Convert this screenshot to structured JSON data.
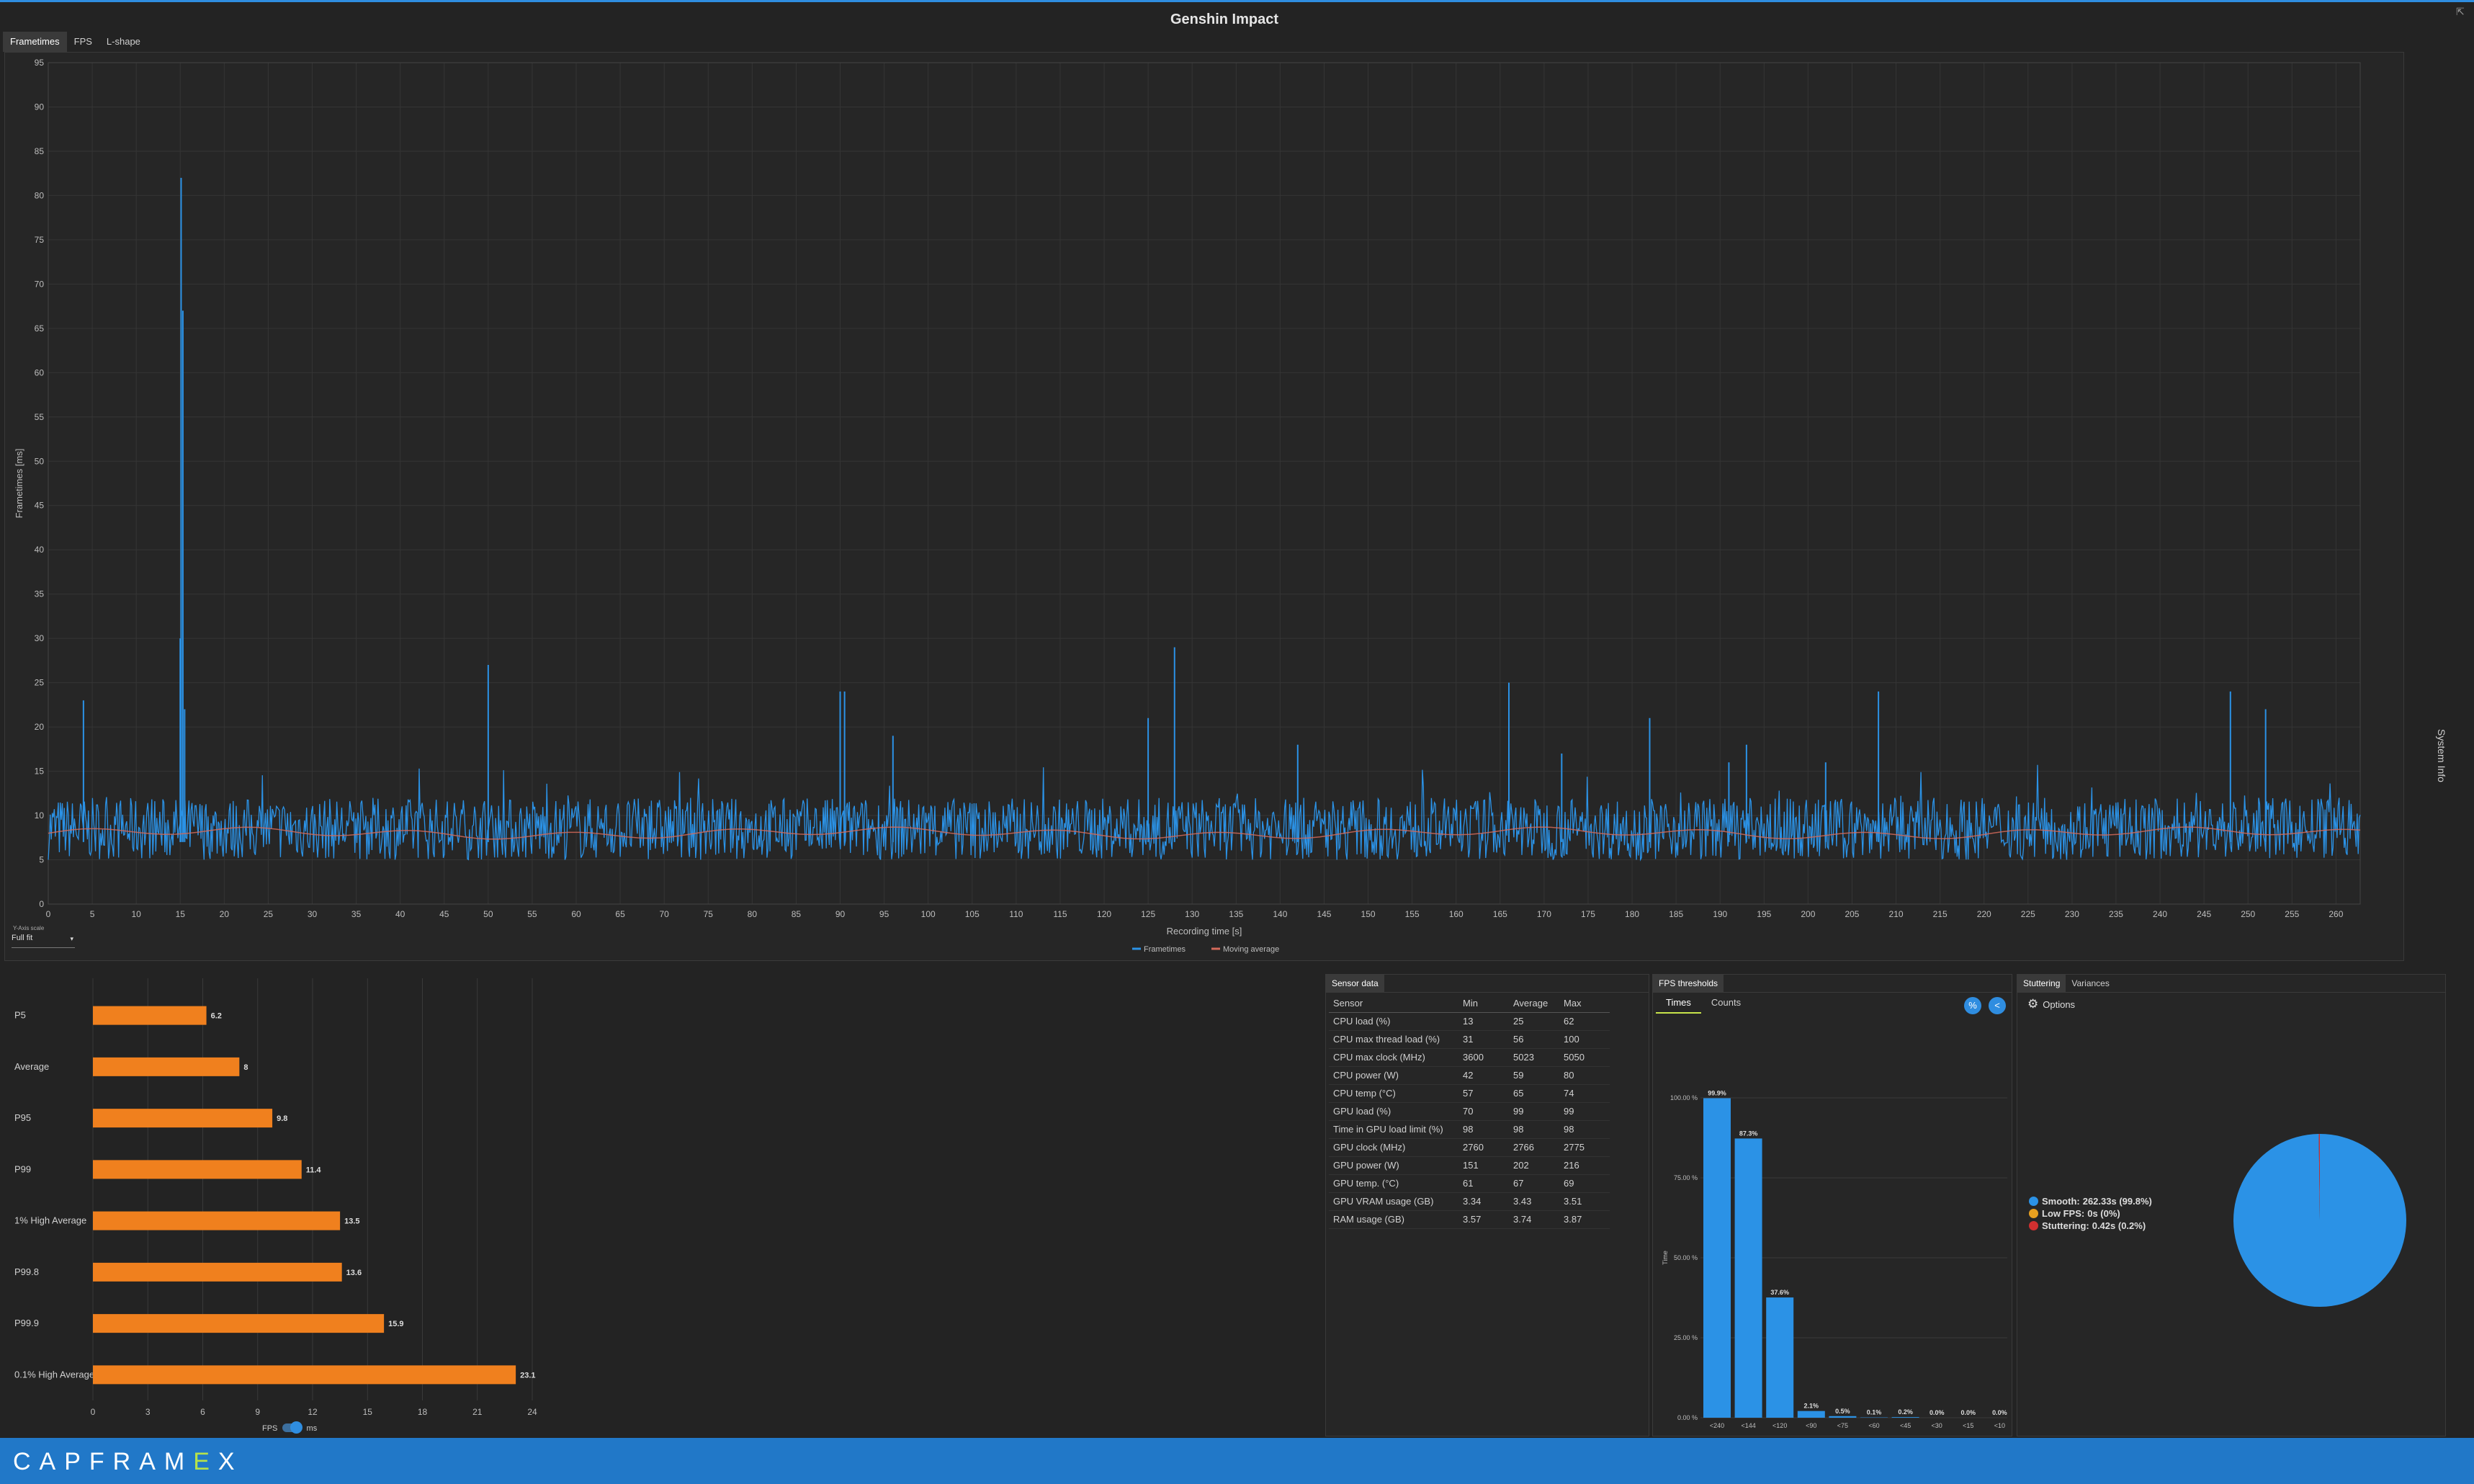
{
  "app": {
    "title": "Genshin Impact",
    "brand_pre": "CAPFRAM",
    "brand_accent": "E",
    "brand_post": "X",
    "restore_glyph": "⇱"
  },
  "main_tabs": [
    {
      "label": "Frametimes",
      "active": true
    },
    {
      "label": "FPS",
      "active": false
    },
    {
      "label": "L-shape",
      "active": false
    }
  ],
  "side_panel_label": "System Info",
  "frametimes": {
    "ylabel": "Frametimes [ms]",
    "xlabel": "Recording time [s]",
    "legend": [
      {
        "name": "Frametimes",
        "color": "#2b92e6"
      },
      {
        "name": "Moving average",
        "color": "#d46a5a"
      }
    ],
    "y_axis_scale_label": "Y-Axis scale",
    "y_axis_scale_value": "Full fit"
  },
  "chart_data": [
    {
      "type": "line",
      "xlabel": "Recording time [s]",
      "ylabel": "Frametimes [ms]",
      "xlim": [
        0,
        262.75
      ],
      "ylim": [
        0,
        95
      ],
      "x_ticks": [
        0,
        5,
        10,
        15,
        20,
        25,
        30,
        35,
        40,
        45,
        50,
        55,
        60,
        65,
        70,
        75,
        80,
        85,
        90,
        95,
        100,
        105,
        110,
        115,
        120,
        125,
        130,
        135,
        140,
        145,
        150,
        155,
        160,
        165,
        170,
        175,
        180,
        185,
        190,
        195,
        200,
        205,
        210,
        215,
        220,
        225,
        230,
        235,
        240,
        245,
        250,
        255,
        260
      ],
      "y_ticks": [
        0,
        5,
        10,
        15,
        20,
        25,
        30,
        35,
        40,
        45,
        50,
        55,
        60,
        65,
        70,
        75,
        80,
        85,
        90,
        95
      ],
      "grid": true,
      "legend_position": "bottom-center",
      "series": [
        {
          "name": "Frametimes",
          "typical_range": [
            5,
            12
          ],
          "spikes": [
            [
              4,
              23
            ],
            [
              15.1,
              82
            ],
            [
              15.3,
              67
            ],
            [
              15,
              30
            ],
            [
              15.5,
              22
            ],
            [
              50,
              27
            ],
            [
              90,
              24
            ],
            [
              90.5,
              24
            ],
            [
              96,
              19
            ],
            [
              128,
              29
            ],
            [
              125,
              21
            ],
            [
              142,
              18
            ],
            [
              166,
              25
            ],
            [
              172,
              17
            ],
            [
              182,
              21
            ],
            [
              191,
              16
            ],
            [
              193,
              18
            ],
            [
              202,
              16
            ],
            [
              208,
              24
            ],
            [
              248,
              24
            ],
            [
              252,
              22
            ]
          ]
        },
        {
          "name": "Moving average",
          "approx_value": 8
        }
      ]
    },
    {
      "type": "bar",
      "orientation": "horizontal",
      "categories": [
        "P5",
        "Average",
        "P95",
        "P99",
        "1% High Average",
        "P99.8",
        "P99.9",
        "0.1% High Average"
      ],
      "values": [
        6.2,
        8,
        9.8,
        11.4,
        13.5,
        13.6,
        15.9,
        23.1
      ],
      "value_labels": [
        "6.2",
        "8",
        "9.8",
        "11.4",
        "13.5",
        "13.6",
        "15.9",
        "23.1"
      ],
      "x_ticks": [
        0,
        3,
        6,
        9,
        12,
        15,
        18,
        21,
        24
      ],
      "xlim": [
        0,
        24
      ],
      "grid": true,
      "color": "#f0801e",
      "unit_toggle": {
        "left": "FPS",
        "right": "ms",
        "selected": "ms"
      }
    },
    {
      "type": "bar",
      "categories": [
        "<240",
        "<144",
        "<120",
        "<90",
        "<75",
        "<60",
        "<45",
        "<30",
        "<15",
        "<10"
      ],
      "values": [
        99.9,
        87.3,
        37.6,
        2.1,
        0.5,
        0.1,
        0.2,
        0.0,
        0.0,
        0.0
      ],
      "value_labels": [
        "99.9%",
        "87.3%",
        "37.6%",
        "2.1%",
        "0.5%",
        "0.1%",
        "0.2%",
        "0.0%",
        "0.0%",
        "0.0%"
      ],
      "ylabel": "Time",
      "y_ticks": [
        "0.00 %",
        "25.00 %",
        "50.00 %",
        "75.00 %",
        "100.00 %"
      ],
      "ylim": [
        0,
        100
      ],
      "color": "#2b92e6"
    },
    {
      "type": "pie",
      "categories": [
        "Smooth",
        "Low FPS",
        "Stuttering"
      ],
      "values": [
        99.8,
        0,
        0.2
      ],
      "colors": [
        "#2b92e6",
        "#e8a020",
        "#d03030"
      ],
      "legend": [
        {
          "label": "Smooth:",
          "value": "262.33s (99.8%)",
          "color": "#2b92e6"
        },
        {
          "label": "Low FPS:",
          "value": "0s (0%)",
          "color": "#e8a020"
        },
        {
          "label": "Stuttering:",
          "value": "0.42s (0.2%)",
          "color": "#d03030"
        }
      ]
    }
  ],
  "sensor": {
    "tab": "Sensor data",
    "columns": [
      "Sensor",
      "Min",
      "Average",
      "Max"
    ],
    "rows": [
      [
        "CPU load (%)",
        "13",
        "25",
        "62"
      ],
      [
        "CPU max thread load (%)",
        "31",
        "56",
        "100"
      ],
      [
        "CPU max clock (MHz)",
        "3600",
        "5023",
        "5050"
      ],
      [
        "CPU power (W)",
        "42",
        "59",
        "80"
      ],
      [
        "CPU temp (°C)",
        "57",
        "65",
        "74"
      ],
      [
        "GPU load (%)",
        "70",
        "99",
        "99"
      ],
      [
        "Time in GPU load limit (%)",
        "98",
        "98",
        "98"
      ],
      [
        "GPU clock (MHz)",
        "2760",
        "2766",
        "2775"
      ],
      [
        "GPU power (W)",
        "151",
        "202",
        "216"
      ],
      [
        "GPU temp. (°C)",
        "61",
        "67",
        "69"
      ],
      [
        "GPU VRAM usage (GB)",
        "3.34",
        "3.43",
        "3.51"
      ],
      [
        "RAM usage (GB)",
        "3.57",
        "3.74",
        "3.87"
      ]
    ]
  },
  "fps_thresholds": {
    "tab": "FPS thresholds",
    "subtabs": [
      {
        "label": "Times",
        "active": true
      },
      {
        "label": "Counts",
        "active": false
      }
    ],
    "percent_btn": "%",
    "share_btn": "<"
  },
  "stuttering": {
    "tabs": [
      {
        "label": "Stuttering",
        "active": true
      },
      {
        "label": "Variances",
        "active": false
      }
    ],
    "options_label": "Options",
    "gear_glyph": "⚙"
  }
}
